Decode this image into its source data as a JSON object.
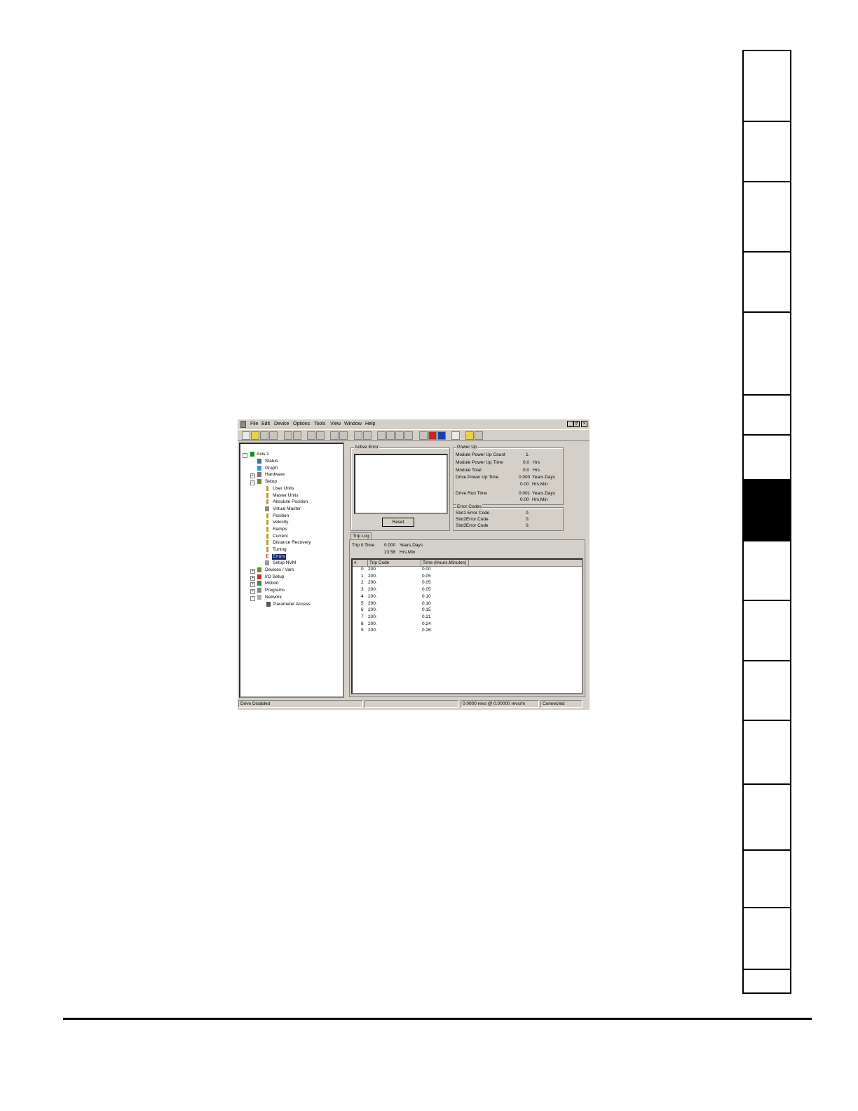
{
  "menu": {
    "items": [
      "File",
      "Edit",
      "Device",
      "Options",
      "Tools",
      "View",
      "Window",
      "Help"
    ]
  },
  "window_buttons": {
    "minimize": "_",
    "restore": "#",
    "close": "×"
  },
  "tree": {
    "root": "Axis 1",
    "items": [
      {
        "label": "Status",
        "icon": "status-icon"
      },
      {
        "label": "Graph",
        "icon": "graph-icon"
      },
      {
        "label": "Hardware",
        "icon": "hardware-icon"
      },
      {
        "label": "Setup",
        "icon": "setup-icon"
      },
      {
        "label": "User Units",
        "icon": "pin-icon"
      },
      {
        "label": "Master Units",
        "icon": "pin-icon"
      },
      {
        "label": "Absolute Position",
        "icon": "pin-icon"
      },
      {
        "label": "Virtual Master",
        "icon": "virtual-master-icon"
      },
      {
        "label": "Position",
        "icon": "pin-icon"
      },
      {
        "label": "Velocity",
        "icon": "pin-icon"
      },
      {
        "label": "Ramps",
        "icon": "pin-icon"
      },
      {
        "label": "Current",
        "icon": "pin-icon"
      },
      {
        "label": "Distance Recovery",
        "icon": "pin-icon"
      },
      {
        "label": "Tuning",
        "icon": "pin-icon"
      },
      {
        "label": "Errors",
        "icon": "error-icon"
      },
      {
        "label": "Setup NVM",
        "icon": "nvm-icon"
      },
      {
        "label": "Devices / Vars",
        "icon": "devices-icon"
      },
      {
        "label": "I/O Setup",
        "icon": "io-icon"
      },
      {
        "label": "Motion",
        "icon": "motion-icon"
      },
      {
        "label": "Programs",
        "icon": "programs-icon"
      },
      {
        "label": "Network",
        "icon": "network-icon"
      },
      {
        "label": "Parameter Access",
        "icon": "parameter-icon"
      }
    ]
  },
  "active_error": {
    "title": "Active Error",
    "reset_label": "Reset"
  },
  "power_up": {
    "title": "Power Up",
    "rows": [
      {
        "label": "Module Power Up Count",
        "value": "1.",
        "unit": ""
      },
      {
        "label": "Module Power Up Time",
        "value": "0.0",
        "unit": "Hrs"
      },
      {
        "label": "Module Total",
        "value": "0.0",
        "unit": "Hrs"
      },
      {
        "label": "Drive Power Up Time",
        "value": "0.000",
        "unit": "Years.Days"
      },
      {
        "label": "",
        "value": "0.00",
        "unit": "Hrs.Min"
      },
      {
        "label": "Drive Run Time",
        "value": "0.001",
        "unit": "Years.Days"
      },
      {
        "label": "",
        "value": "0.00",
        "unit": "Hrs.Min"
      }
    ]
  },
  "error_codes": {
    "title": "Error Codes",
    "rows": [
      {
        "label": "Slot1 Error Code",
        "value": "0."
      },
      {
        "label": "Slot2Error Code",
        "value": "0."
      },
      {
        "label": "Slot3Error Code",
        "value": "0."
      }
    ]
  },
  "trip_log": {
    "tab_label": "Trip Log",
    "trip0_label": "Trip 0 Time",
    "trip0_value1": "0.000",
    "trip0_unit1": "Years.Days",
    "trip0_value2": "23.58",
    "trip0_unit2": "Hrs.Min",
    "columns": [
      "#",
      "Trip Code",
      "Time (Hours.Minutes)"
    ],
    "rows": [
      {
        "n": "0",
        "code": "200.",
        "time": "0.00"
      },
      {
        "n": "1",
        "code": "200.",
        "time": "0.05"
      },
      {
        "n": "2",
        "code": "200.",
        "time": "0.05"
      },
      {
        "n": "3",
        "code": "200.",
        "time": "0.05"
      },
      {
        "n": "4",
        "code": "200.",
        "time": "0.10"
      },
      {
        "n": "5",
        "code": "200.",
        "time": "0.10"
      },
      {
        "n": "6",
        "code": "200.",
        "time": "0.15"
      },
      {
        "n": "7",
        "code": "200.",
        "time": "0.21"
      },
      {
        "n": "8",
        "code": "200.",
        "time": "0.24"
      },
      {
        "n": "9",
        "code": "200.",
        "time": "0.26"
      }
    ]
  },
  "status_bar": {
    "left": "Drive Disabled",
    "position": "0.0000 revs @ 0.00000 revs/m",
    "connection": "Connected"
  }
}
